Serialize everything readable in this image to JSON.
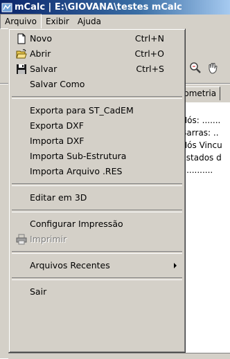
{
  "window": {
    "title": "mCalc | E:\\GIOVANA\\testes mCalc"
  },
  "menubar": {
    "items": [
      {
        "label": "Arquivo"
      },
      {
        "label": "Exibir"
      },
      {
        "label": "Ajuda"
      }
    ]
  },
  "background": {
    "tab_label": "eometria",
    "lines": [
      "e Nós: .......",
      "e Barras: ..",
      "e Nós Vincu",
      "e Estados d",
      "..............."
    ]
  },
  "menu": {
    "novo": {
      "label": "Novo",
      "shortcut": "Ctrl+N"
    },
    "abrir": {
      "label": "Abrir",
      "shortcut": "Ctrl+O"
    },
    "salvar": {
      "label": "Salvar",
      "shortcut": "Ctrl+S"
    },
    "salvar_como": {
      "label": "Salvar Como"
    },
    "exporta_st": {
      "label": "Exporta para ST_CadEM"
    },
    "exporta_dxf": {
      "label": "Exporta DXF"
    },
    "importa_dxf": {
      "label": "Importa DXF"
    },
    "importa_sub": {
      "label": "Importa Sub-Estrutura"
    },
    "importa_res": {
      "label": "Importa Arquivo .RES"
    },
    "editar_3d": {
      "label": "Editar em 3D"
    },
    "config_impressao": {
      "label": "Configurar Impressão"
    },
    "imprimir": {
      "label": "Imprimir"
    },
    "recentes": {
      "label": "Arquivos Recentes"
    },
    "sair": {
      "label": "Sair"
    }
  }
}
